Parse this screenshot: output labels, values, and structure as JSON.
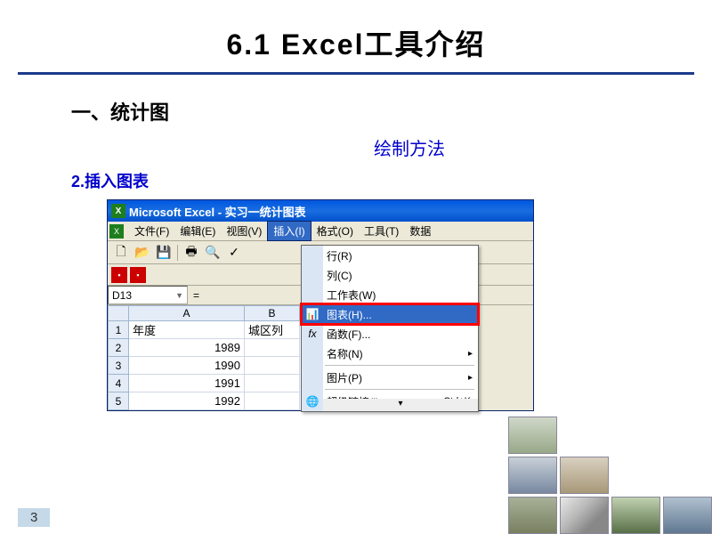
{
  "slide": {
    "title": "6.1 Excel工具介绍",
    "heading1": "一、统计图",
    "method_label": "绘制方法",
    "heading2": "2.插入图表",
    "page_number": "3"
  },
  "excel": {
    "titlebar": "Microsoft Excel - 实习一统计图表",
    "menus": {
      "file": "文件(F)",
      "edit": "编辑(E)",
      "view": "视图(V)",
      "insert": "插入(I)",
      "format": "格式(O)",
      "tools": "工具(T)",
      "data": "数据"
    },
    "name_box": "D13",
    "fx_symbol": "=",
    "columns": [
      "A",
      "B"
    ],
    "col_b_partial": "城区列",
    "rows": [
      {
        "n": "1",
        "a": "年度",
        "b": "城区列"
      },
      {
        "n": "2",
        "a": "1989",
        "b": ""
      },
      {
        "n": "3",
        "a": "1990",
        "b": ""
      },
      {
        "n": "4",
        "a": "1991",
        "b": ""
      },
      {
        "n": "5",
        "a": "1992",
        "b": ""
      }
    ],
    "dropdown": {
      "row": "行(R)",
      "col": "列(C)",
      "worksheet": "工作表(W)",
      "chart": "图表(H)...",
      "function": "函数(F)...",
      "name": "名称(N)",
      "picture": "图片(P)",
      "hyperlink": "超级链接(I)...",
      "hyperlink_shortcut": "Ctrl+K"
    }
  }
}
